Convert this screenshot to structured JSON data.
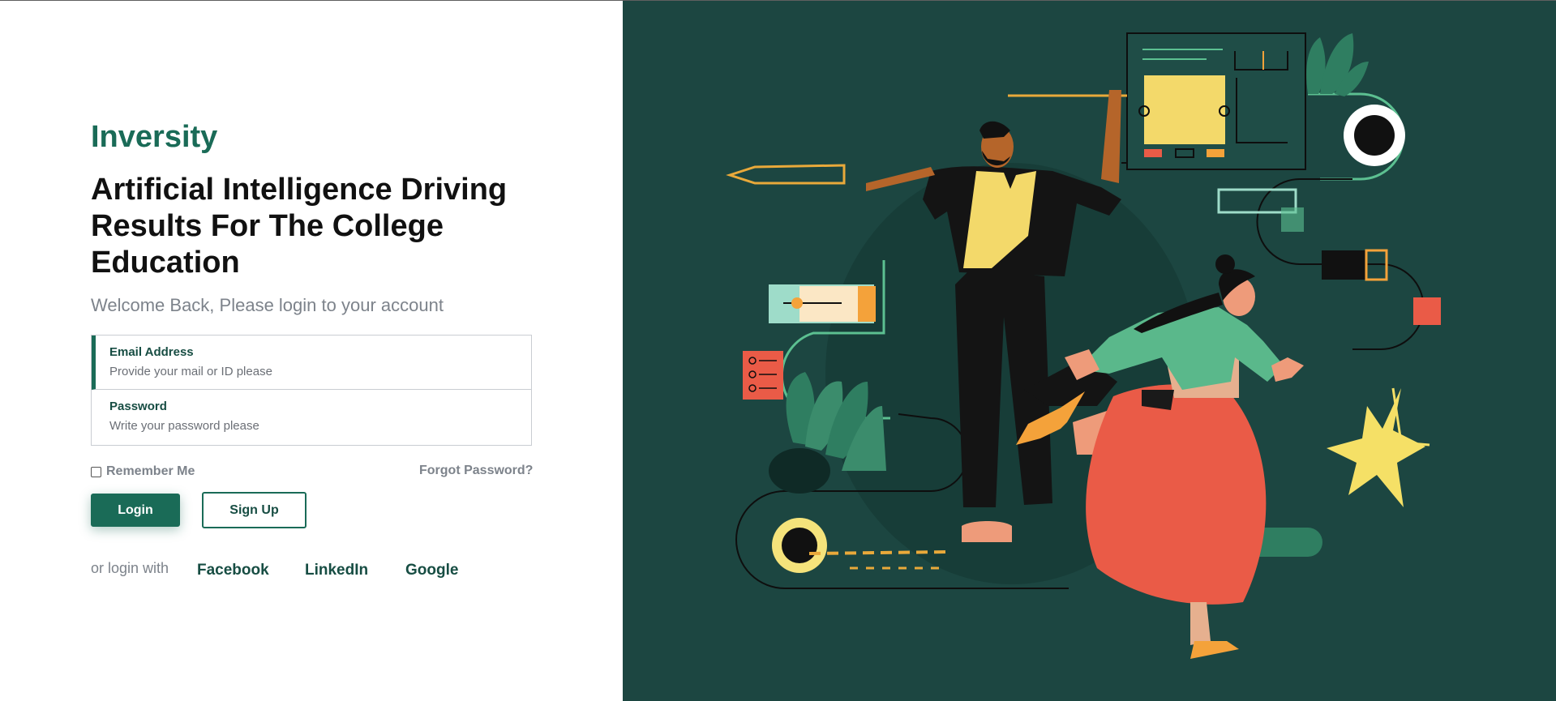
{
  "brand": "Inversity",
  "headline": "Artificial Intelligence Driving Results For The College Education",
  "welcome": "Welcome Back, Please login to your account",
  "form": {
    "email_label": "Email Address",
    "email_placeholder": "Provide your mail or ID please",
    "password_label": "Password",
    "password_placeholder": "Write your password please"
  },
  "remember_label": "Remember Me",
  "forgot_label": "Forgot Password?",
  "buttons": {
    "login": "Login",
    "signup": "Sign Up"
  },
  "social": {
    "prefix": "or login with",
    "facebook": "Facebook",
    "linkedin": "LinkedIn",
    "google": "Google"
  },
  "colors": {
    "brand": "#1a6b57",
    "illustration_bg": "#1c4641",
    "muted_text": "#7d838b"
  }
}
